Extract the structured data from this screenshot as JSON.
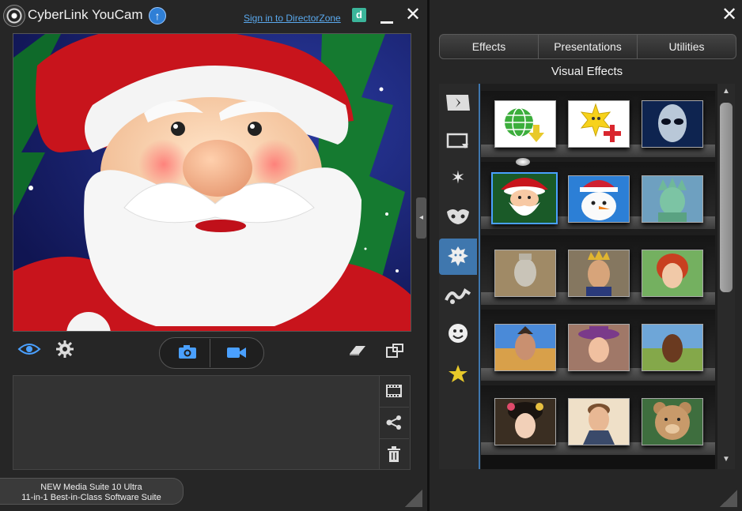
{
  "app": {
    "title": "CyberLink YouCam",
    "signin_link": "Sign in to DirectorZone",
    "directorzone_letter": "d"
  },
  "promo": {
    "line1": "NEW Media Suite 10 Ultra",
    "line2": "11-in-1 Best-in-Class Software Suite"
  },
  "right": {
    "tabs": [
      "Effects",
      "Presentations",
      "Utilities"
    ],
    "section_title": "Visual Effects",
    "categories": [
      {
        "icon": "scene-icon"
      },
      {
        "icon": "frame-icon"
      },
      {
        "icon": "magic-wand-icon"
      },
      {
        "icon": "masks-icon"
      },
      {
        "icon": "avatar-icon",
        "selected": true
      },
      {
        "icon": "distortion-icon"
      },
      {
        "icon": "emotion-icon"
      },
      {
        "icon": "gadget-icon"
      }
    ],
    "effects": [
      {
        "icon": "download-globe-icon"
      },
      {
        "icon": "add-effect-icon"
      },
      {
        "icon": "alien-thumbnail"
      },
      {
        "icon": "santa-thumbnail",
        "selected": true
      },
      {
        "icon": "snowman-thumbnail"
      },
      {
        "icon": "statue-of-liberty-thumbnail"
      },
      {
        "icon": "terracotta-warrior-thumbnail"
      },
      {
        "icon": "king-thumbnail"
      },
      {
        "icon": "redhead-woman-thumbnail"
      },
      {
        "icon": "man-desert-thumbnail"
      },
      {
        "icon": "woman-hat-thumbnail"
      },
      {
        "icon": "man-savanna-thumbnail"
      },
      {
        "icon": "geisha-thumbnail"
      },
      {
        "icon": "man-suit-thumbnail"
      },
      {
        "icon": "teddy-bear-thumbnail"
      }
    ]
  },
  "colors": {
    "accent": "#3f77ae",
    "link": "#5aa9ee",
    "background": "#262626"
  }
}
